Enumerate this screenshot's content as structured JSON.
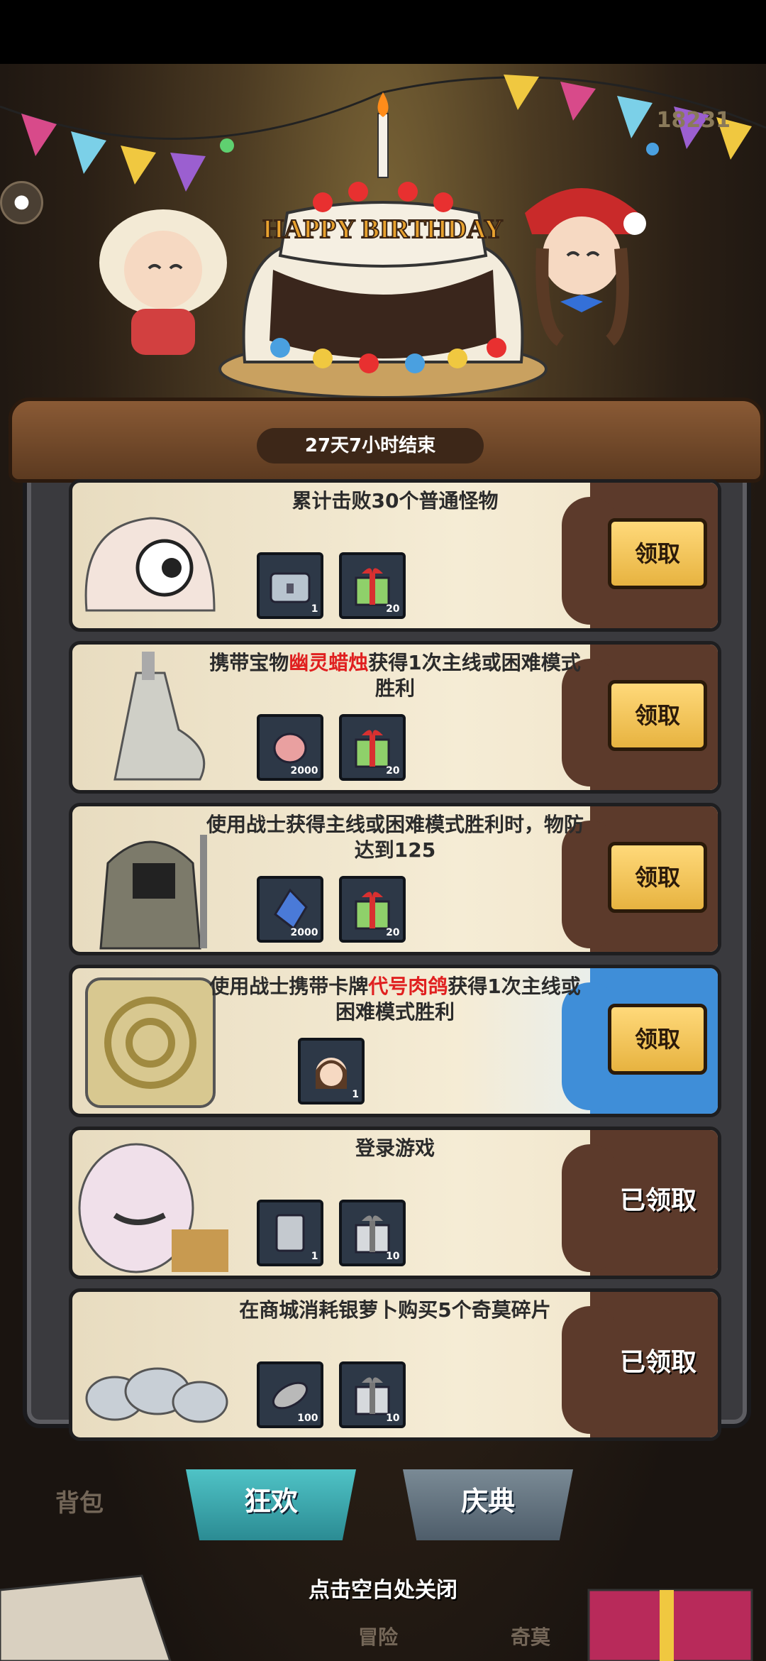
{
  "header": {
    "score": "18231",
    "help_icon": "help-bubble-icon"
  },
  "event": {
    "cake_text": "HAPPY BIRTHDAY",
    "timer": "27天7小时结束"
  },
  "tasks": [
    {
      "title_pre": "累计击败30个普通怪物",
      "title_hl": "",
      "title_post": "",
      "rewards": [
        {
          "icon": "silver-chest-icon",
          "qty": "1"
        },
        {
          "icon": "gift-box-icon",
          "qty": "20"
        }
      ],
      "action": "领取",
      "status": "claim"
    },
    {
      "title_pre": "携带宝物",
      "title_hl": "幽灵蜡烛",
      "title_post": "获得1次主线或困难模式胜利",
      "rewards": [
        {
          "icon": "meat-icon",
          "qty": "2000"
        },
        {
          "icon": "gift-box-icon",
          "qty": "20"
        }
      ],
      "action": "领取",
      "status": "claim"
    },
    {
      "title_pre": "使用战士获得主线或困难模式胜利时，物防达到125",
      "title_hl": "",
      "title_post": "",
      "rewards": [
        {
          "icon": "blue-crystal-icon",
          "qty": "2000"
        },
        {
          "icon": "gift-box-icon",
          "qty": "20"
        }
      ],
      "action": "领取",
      "status": "claim"
    },
    {
      "title_pre": "使用战士携带卡牌",
      "title_hl": "代号肉鸽",
      "title_post": "获得1次主线或困难模式胜利",
      "rewards": [
        {
          "icon": "character-card-icon",
          "qty": "1"
        }
      ],
      "action": "领取",
      "status": "claim"
    },
    {
      "title_pre": "登录游戏",
      "title_hl": "",
      "title_post": "",
      "rewards": [
        {
          "icon": "silver-card-icon",
          "qty": "1"
        },
        {
          "icon": "silver-gift-icon",
          "qty": "10"
        }
      ],
      "action": "已领取",
      "status": "claimed"
    },
    {
      "title_pre": "在商城消耗银萝卜购买5个奇莫碎片",
      "title_hl": "",
      "title_post": "",
      "rewards": [
        {
          "icon": "bread-icon",
          "qty": "100"
        },
        {
          "icon": "silver-gift-icon",
          "qty": "10"
        }
      ],
      "action": "已领取",
      "status": "claimed"
    }
  ],
  "tabs": {
    "active": "狂欢",
    "inactive": "庆典"
  },
  "background_labels": {
    "bag": "背包",
    "adventure": "冒险",
    "qimo": "奇莫"
  },
  "close_hint": "点击空白处关闭",
  "colors": {
    "highlight": "#e02020",
    "claim_button": "#e7b340",
    "tab_active": "#2b8b93"
  }
}
